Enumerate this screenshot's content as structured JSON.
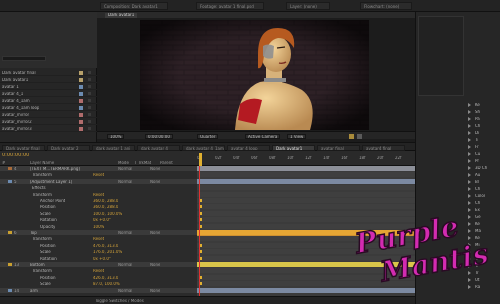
{
  "window": {
    "tabs": [
      "Composition: Dark avatar1",
      "Footage: avatar 1 final.psd",
      "Layer: (none)",
      "Flowchart: (none)"
    ]
  },
  "project": {
    "items": [
      {
        "name": "Dark avatar final",
        "color": "#b7a06a"
      },
      {
        "name": "Dark avatar1",
        "color": "#b7a06a"
      },
      {
        "name": "avatar 1",
        "color": "#6c8bb0"
      },
      {
        "name": "avatar 4_1",
        "color": "#6c8bb0"
      },
      {
        "name": "avatar 4_1am",
        "color": "#b06c6c"
      },
      {
        "name": "avatar 4_1am loop",
        "color": "#6c8bb0"
      },
      {
        "name": "avatar_mirror",
        "color": "#b06c6c"
      },
      {
        "name": "avatar_mirror2",
        "color": "#b06c6c"
      },
      {
        "name": "avatar_mirror3",
        "color": "#b06c6c"
      }
    ],
    "footer": "8 bpc"
  },
  "viewer": {
    "tab": "Dark avatar1",
    "controls": [
      "100%",
      "0:00:00:00",
      "Quarter",
      "Active Camera",
      "1 View"
    ]
  },
  "right_panel": {
    "items": [
      "Ke",
      "Sh",
      "Pa",
      "Ch",
      "Di",
      "Ti",
      "Fr",
      "Cu",
      "Pr",
      "3D Ch",
      "Au",
      "Bl",
      "Ch",
      "Color",
      "Ch",
      "Ex",
      "Ge",
      "Ke",
      "Ma",
      "Ke",
      "Mi",
      "Te",
      "Ti",
      "Ti",
      "Tr",
      "Ut",
      "Ra"
    ]
  },
  "timeline": {
    "tabs": [
      "Dark avatar final",
      "Dark avatar 2",
      "dark avatar 1 ani",
      "dark avatar 4",
      "dark avatar 4_1am",
      "avatar 4 loop",
      "Dark avatar1",
      "avatar final",
      "avatar4 final"
    ],
    "active_tab": 6,
    "timecode": "0:00:00:00",
    "column_headers": [
      "#",
      "Layer Name",
      "Mode",
      "T",
      "TrkMat",
      "Parent"
    ],
    "ruler": [
      "0s",
      "02f",
      "04f",
      "06f",
      "08f",
      "10f",
      "12f",
      "14f",
      "16f",
      "18f",
      "20f",
      "22f"
    ],
    "layers": [
      {
        "num": "4",
        "label": "[TEXT M...TERMARK.png]",
        "mode": "Normal",
        "parent": "None",
        "color": "#a86b3a",
        "kind": "layer"
      },
      {
        "num": "",
        "label": "Transform",
        "value": "Reset",
        "kind": "sub"
      },
      {
        "num": "5",
        "label": "[Adjustment Layer 1]",
        "mode": "Normal",
        "parent": "None",
        "color": "#6c8bb0",
        "kind": "layer"
      },
      {
        "num": "",
        "label": "Effects",
        "kind": "sub"
      },
      {
        "num": "",
        "label": "Transform",
        "value": "Reset",
        "kind": "sub"
      },
      {
        "num": "",
        "label": "Anchor Point",
        "value": "360.0, 288.0",
        "kind": "prop"
      },
      {
        "num": "",
        "label": "Position",
        "value": "360.0, 288.0",
        "kind": "prop"
      },
      {
        "num": "",
        "label": "Scale",
        "value": "100.0, 100.0%",
        "kind": "prop"
      },
      {
        "num": "",
        "label": "Rotation",
        "value": "0x +0.0°",
        "kind": "prop"
      },
      {
        "num": "",
        "label": "Opacity",
        "value": "100%",
        "kind": "prop"
      },
      {
        "num": "6",
        "label": "Top",
        "mode": "Normal",
        "parent": "None",
        "color": "#c9a030",
        "kind": "layer"
      },
      {
        "num": "",
        "label": "Transform",
        "value": "Reset",
        "kind": "sub"
      },
      {
        "num": "",
        "label": "Position",
        "value": "476.0, 313.0",
        "kind": "prop"
      },
      {
        "num": "",
        "label": "Scale",
        "value": "176.0, 201.0%",
        "kind": "prop"
      },
      {
        "num": "",
        "label": "Rotation",
        "value": "0x +0.0°",
        "kind": "prop"
      },
      {
        "num": "13",
        "label": "Bottom",
        "mode": "Normal",
        "parent": "None",
        "color": "#c9a030",
        "kind": "layer"
      },
      {
        "num": "",
        "label": "Transform",
        "value": "Reset",
        "kind": "sub"
      },
      {
        "num": "",
        "label": "Position",
        "value": "426.0, 313.0",
        "kind": "prop"
      },
      {
        "num": "",
        "label": "Scale",
        "value": "87.0, 100.0%",
        "kind": "prop"
      },
      {
        "num": "14",
        "label": "arm",
        "mode": "Normal",
        "parent": "None",
        "color": "#6c8bb0",
        "kind": "layer"
      }
    ],
    "bottom_label": "Toggle Switches / Modes"
  },
  "logo": {
    "line1": "Purple",
    "line2": "Mantis"
  },
  "colors": {
    "accent_orange": "#d4a33a",
    "logo_purple": "#c020a0",
    "track_yellow": "#d9c64a",
    "track_orange": "#e8a030"
  }
}
